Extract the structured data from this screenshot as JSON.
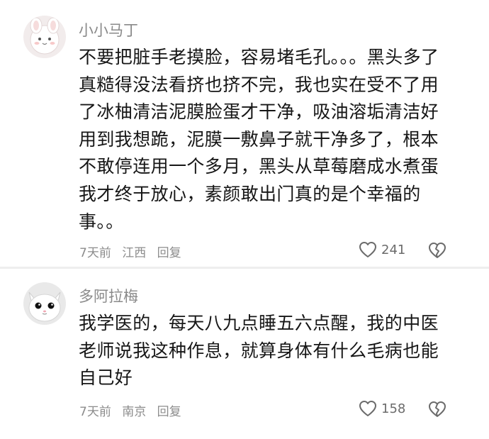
{
  "comments": [
    {
      "username": "小小马丁",
      "avatar_icon": "bunny-avatar-icon",
      "text": "不要把脏手老摸脸，容易堵毛孔。。。黑头多了真糙得没法看挤也挤不完，我也实在受不了用了冰柚清洁泥膜脸蛋才干净，吸油溶垢清洁好用到我想跪，泥膜一敷鼻子就干净多了，根本不敢停连用一个多月，黑头从草莓磨成水煮蛋我才终于放心，素颜敢出门真的是个幸福的事。。",
      "time": "7天前",
      "location": "江西",
      "reply_label": "回复",
      "likes": "241"
    },
    {
      "username": "多阿拉梅",
      "avatar_icon": "kitten-avatar-icon",
      "text": "我学医的，每天八九点睡五六点醒，我的中医老师说我这种作息，就算身体有什么毛病也能自己好",
      "time": "7天前",
      "location": "南京",
      "reply_label": "回复",
      "likes": "158"
    }
  ],
  "colors": {
    "text": "#161616",
    "muted": "#8a8a8a",
    "divider": "#eeeeee",
    "icon": "#6b6b6b"
  }
}
